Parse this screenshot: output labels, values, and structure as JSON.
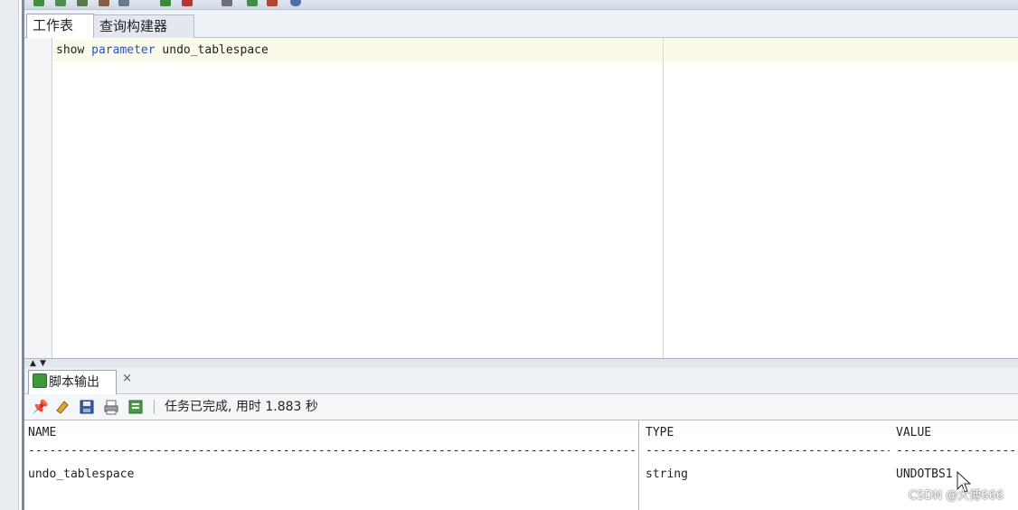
{
  "window": {
    "tabs": [
      "工作表",
      "查询构建器"
    ],
    "active_tab_index": 0
  },
  "editor": {
    "code_tokens": [
      {
        "text": "show ",
        "kind": "plain"
      },
      {
        "text": "parameter",
        "kind": "keyword"
      },
      {
        "text": " undo_tablespace",
        "kind": "plain"
      }
    ]
  },
  "output": {
    "tab_label": "脚本输出",
    "tab_close": "×",
    "status": "任务已完成, 用时 1.883 秒",
    "toolbar_icons": [
      "pin-icon",
      "eraser-icon",
      "save-icon",
      "print-icon",
      "script-icon"
    ],
    "columns": [
      {
        "header": "NAME",
        "dashes": "--------------------------------------------------------------------------------------------------",
        "value": "undo_tablespace"
      },
      {
        "header": "TYPE",
        "dashes": "-----------------------------------------------",
        "value": "string"
      },
      {
        "header": "VALUE",
        "dashes": "------------------------------",
        "value": "UNDOTBS1"
      }
    ]
  },
  "watermark": "CSDN @大博666",
  "colors": {
    "keyword": "#2a55b8",
    "current_line": "#fbfae8"
  }
}
